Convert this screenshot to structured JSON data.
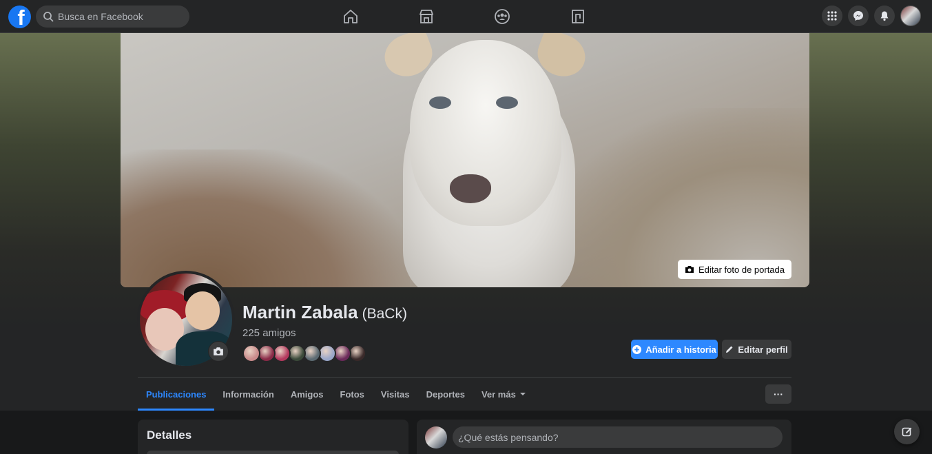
{
  "topbar": {
    "logo_letter": "f",
    "search_placeholder": "Busca en Facebook",
    "nav_icons": [
      "home-icon",
      "marketplace-icon",
      "groups-icon",
      "gaming-icon"
    ],
    "right_icons": [
      "menu-grid-icon",
      "messenger-icon",
      "notifications-icon",
      "account-avatar"
    ]
  },
  "cover": {
    "edit_label": "Editar foto de portada"
  },
  "profile": {
    "name": "Martin Zabala",
    "nickname": "(BaCk)",
    "friends_count": "225 amigos",
    "friend_avatar_colors": [
      "#c98b8b",
      "#8a2b48",
      "#b3395e",
      "#3b4a3a",
      "#5c6a72",
      "#9aa7c9",
      "#6b2a5a",
      "#3a2a2a"
    ]
  },
  "actions": {
    "add_story": "Añadir a historia",
    "edit_profile": "Editar perfil",
    "more": "···"
  },
  "tabs": [
    {
      "label": "Publicaciones",
      "active": true
    },
    {
      "label": "Información"
    },
    {
      "label": "Amigos"
    },
    {
      "label": "Fotos"
    },
    {
      "label": "Visitas"
    },
    {
      "label": "Deportes"
    },
    {
      "label": "Ver más"
    }
  ],
  "details": {
    "title": "Detalles"
  },
  "composer": {
    "placeholder": "¿Qué estás pensando?"
  },
  "colors": {
    "accent": "#2d88ff",
    "surface": "#242526",
    "background": "#18191a"
  }
}
